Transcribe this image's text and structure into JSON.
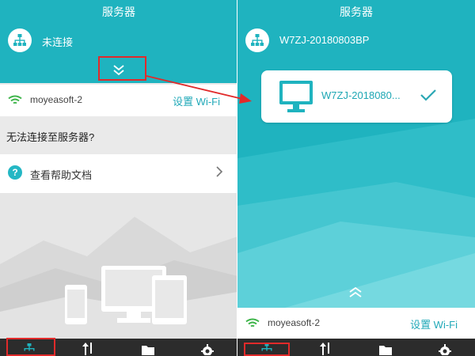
{
  "left": {
    "title": "服务器",
    "status_text": "未连接",
    "wifi": {
      "ssid": "moyeasoft-2",
      "setting_label": "设置 Wi-Fi"
    },
    "error_text": "无法连接至服务器?",
    "help": {
      "icon_glyph": "?",
      "label": "查看帮助文档"
    }
  },
  "right": {
    "title": "服务器",
    "connected_server": "W7ZJ-20180803BP",
    "device_card": {
      "name": "W7ZJ-2018080..."
    },
    "wifi": {
      "ssid": "moyeasoft-2",
      "setting_label": "设置 Wi-Fi"
    }
  },
  "bottom_nav": {
    "items": [
      {
        "name": "server",
        "icon": "network-icon",
        "active": true
      },
      {
        "name": "transfer",
        "icon": "transfer-arrows-icon",
        "active": false
      },
      {
        "name": "files",
        "icon": "folder-icon",
        "active": false
      },
      {
        "name": "settings",
        "icon": "gear-icon",
        "active": false
      }
    ]
  },
  "colors": {
    "teal": "#1fb3bf",
    "teal_text": "#21a9b8",
    "green_wifi": "#3fb54b",
    "annotation_red": "#e12a2a",
    "nav_bg": "#2c2c2c"
  }
}
